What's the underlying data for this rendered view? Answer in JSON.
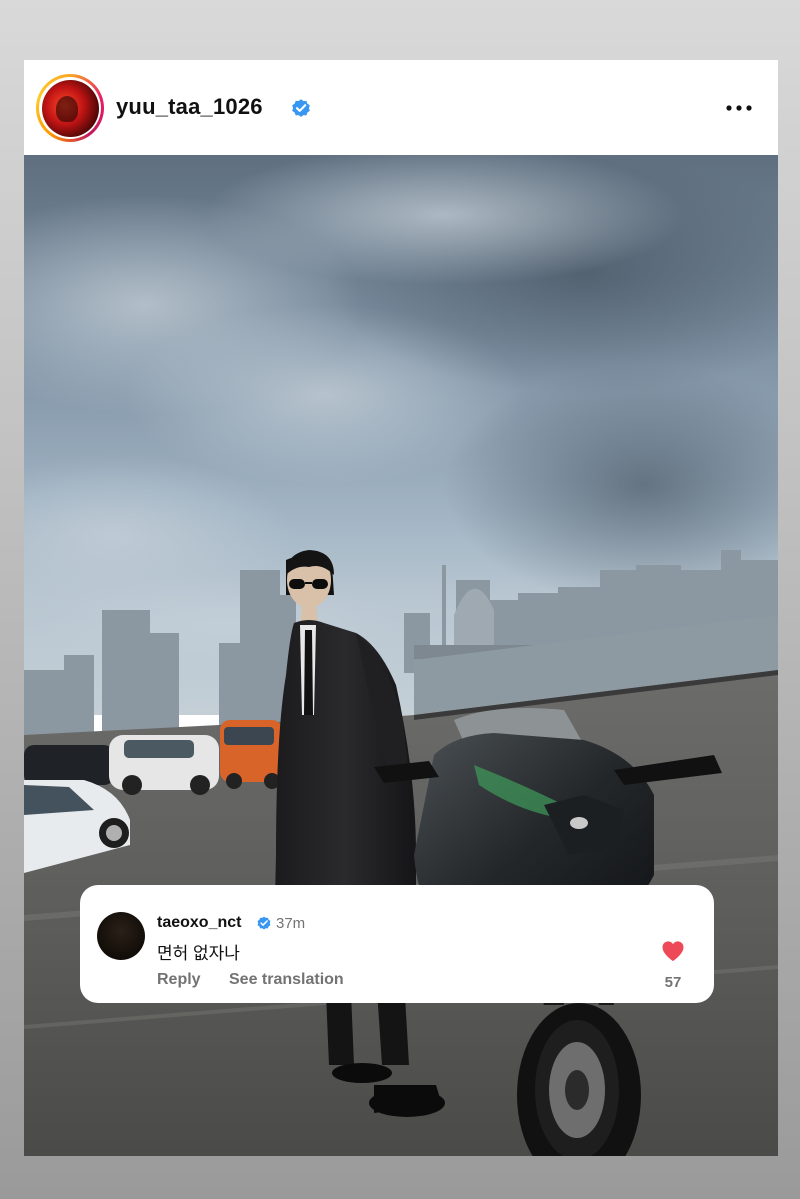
{
  "post": {
    "username": "yuu_taa_1026",
    "avatar_icon": "profile-photo-avatar",
    "verified_icon": "verified-badge-icon",
    "menu_icon": "more-options-icon",
    "photo_description_icon": "post-photo"
  },
  "comment": {
    "username": "taeoxo_nct",
    "time": "37m",
    "text": "면허 없자나",
    "reply_label": "Reply",
    "translate_label": "See translation",
    "like_count": "57",
    "heart_color": "#ed4956",
    "verified_color": "#3897f0"
  }
}
